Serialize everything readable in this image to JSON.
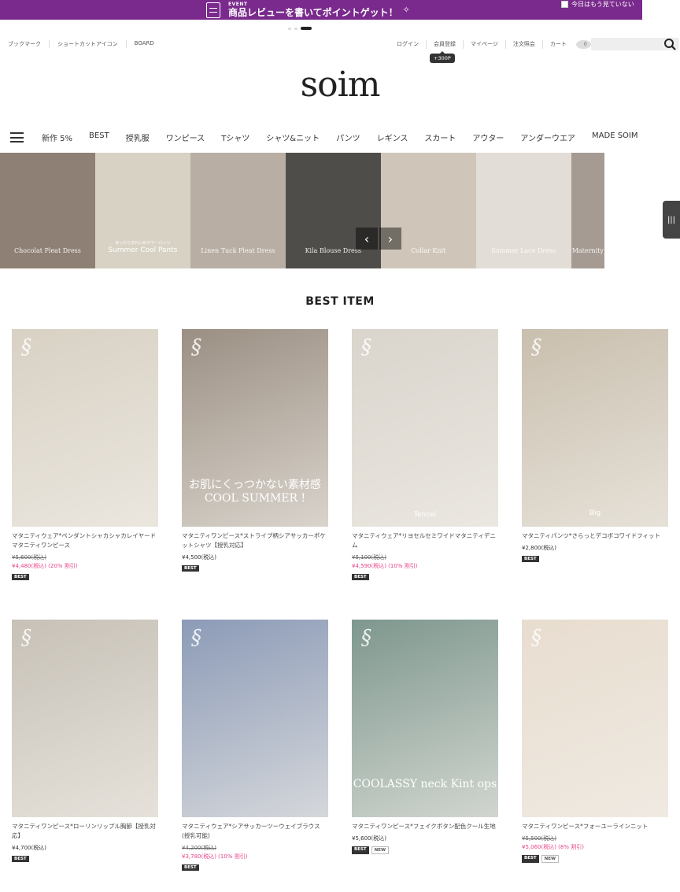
{
  "event_banner": {
    "tag": "EVENT",
    "title": "商品レビューを書いてポイントゲット！",
    "hide_today": "今日はもう見ていない"
  },
  "util_left": [
    "ブックマーク",
    "ショートカットアイコン",
    "BOARD"
  ],
  "util_right": [
    "ログイン",
    "会員登録",
    "マイページ",
    "注文照会",
    "カート"
  ],
  "cart_count": "0",
  "points_badge": "+300P",
  "logo": "soim",
  "categories": [
    "新作 5%",
    "BEST",
    "授乳服",
    "ワンピース",
    "Tシャツ",
    "シャツ&ニット",
    "パンツ",
    "レギンス",
    "スカート",
    "アウター",
    "アンダーウエア",
    "MADE SOIM"
  ],
  "hero_tiles": [
    {
      "caption": "Chocolat Pleat Dress",
      "sub": "",
      "color": "#8e8074"
    },
    {
      "caption": "Summer Cool Pants",
      "sub": "ゆったりきれいめサマーパンツ",
      "color": "#d8d2c5"
    },
    {
      "caption": "Linen Tuck Pleat Dress",
      "sub": "",
      "color": "#b8aea3"
    },
    {
      "caption": "Kila Blouse Dress",
      "sub": "",
      "color": "#4f4d4a"
    },
    {
      "caption": "Collar Knit",
      "sub": "",
      "color": "#cfc6b9"
    },
    {
      "caption": "Summer Lace Dress",
      "sub": "",
      "color": "#e2ddd6"
    },
    {
      "caption": "Maternity",
      "sub": "",
      "color": "#a59b92"
    }
  ],
  "section_title": "BEST ITEM",
  "products": [
    {
      "name": "マタニティウェア*ペンダントシャカシャカレイヤードマタニティワンピース",
      "price": "¥5,600(税込)",
      "sale": "¥4,480(税込) (20% 割引)",
      "badges": [
        "BEST"
      ],
      "img_color": "#d8d1c4",
      "overlay": ""
    },
    {
      "name": "マタニティワンピース*ストライプ柄シアサッカーポケットシャツ【授乳対応】",
      "price": "¥4,500(税込)",
      "sale": "",
      "badges": [
        "BEST"
      ],
      "img_color": "#9b8f83",
      "overlay": "お肌にくっつかない素材感 COOL SUMMER !"
    },
    {
      "name": "マタニティウェア*リヨセルセミワイドマタニティデニム",
      "price": "¥5,100(税込)",
      "sale": "¥4,590(税込) (10% 割引)",
      "badges": [
        "BEST"
      ],
      "img_color": "#d9d4cc",
      "overlay": "Tencel"
    },
    {
      "name": "マタニティパンツ*さらっとデコボコワイドフィット",
      "price": "¥2,800(税込)",
      "sale": "",
      "badges": [
        "BEST"
      ],
      "img_color": "#c9bfae",
      "overlay": "Big"
    },
    {
      "name": "マタニティワンピース*ローリンリップル胸節【授乳対応】",
      "price": "¥4,700(税込)",
      "sale": "",
      "badges": [
        "BEST"
      ],
      "img_color": "#c7c1b7",
      "overlay": ""
    },
    {
      "name": "マタニティウェア*シアサッカーツーウェイブラウス(授乳可能)",
      "price": "¥4,200(税込)",
      "sale": "¥3,780(税込) (10% 割引)",
      "badges": [
        "BEST"
      ],
      "img_color": "#8c9bb7",
      "overlay": ""
    },
    {
      "name": "マタニティワンピース*フェイクボタン配色クール生地",
      "price": "¥5,600(税込)",
      "sale": "",
      "badges": [
        "BEST",
        "NEW"
      ],
      "img_color": "#7e978e",
      "overlay": "COOLASSY neck Kint ops"
    },
    {
      "name": "マタニティワンピース*フォーユーラインニット",
      "price": "¥5,500(税込)",
      "sale": "¥5,060(税込) (8% 割引)",
      "badges": [
        "BEST",
        "NEW"
      ],
      "img_color": "#e8ddcf",
      "overlay": ""
    }
  ]
}
